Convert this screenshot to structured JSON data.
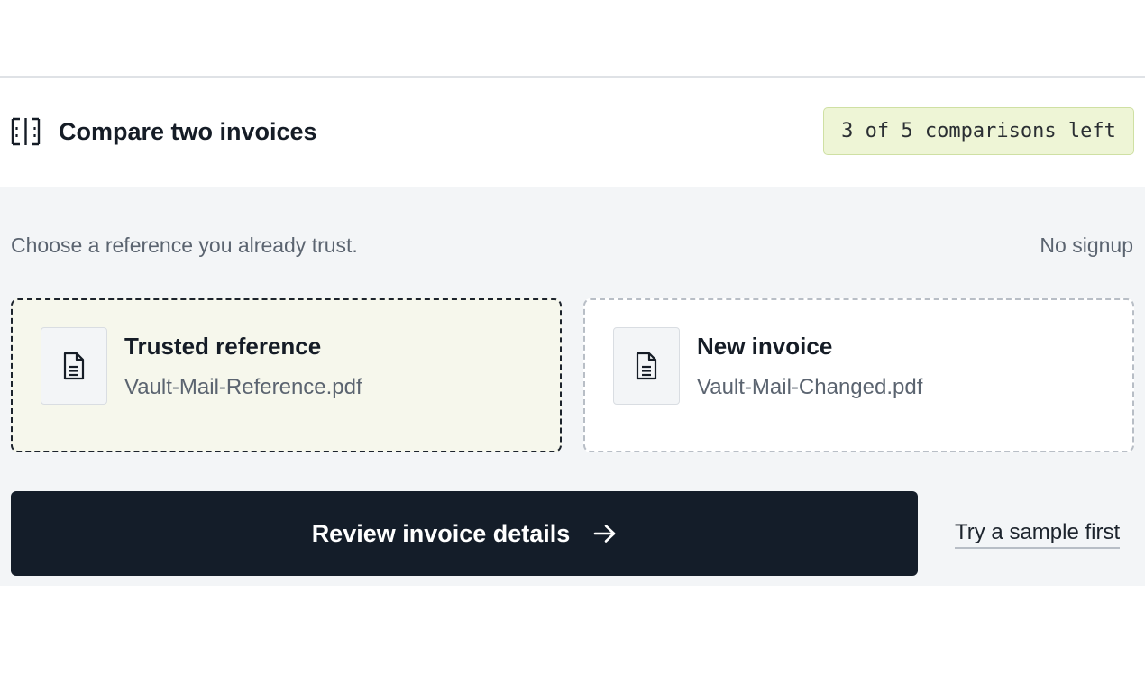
{
  "header": {
    "title": "Compare two invoices",
    "icon": "compare-columns-icon",
    "quota_badge": "3 of 5 comparisons left"
  },
  "intro": {
    "hint": "Choose a reference you already trust.",
    "no_signup": "No signup"
  },
  "cards": [
    {
      "label": "Trusted reference",
      "file_name": "Vault-Mail-Reference.pdf",
      "icon": "document-icon",
      "selected": true
    },
    {
      "label": "New invoice",
      "file_name": "Vault-Mail-Changed.pdf",
      "icon": "document-icon",
      "selected": false
    }
  ],
  "actions": {
    "primary_label": "Review invoice details",
    "primary_icon": "arrow-right-icon",
    "secondary_label": "Try a sample first"
  },
  "colors": {
    "primary_button": "#141d29",
    "badge_background": "#eef5d6",
    "selected_card_background": "#f6f7ec",
    "panel_background": "#f3f5f7"
  }
}
